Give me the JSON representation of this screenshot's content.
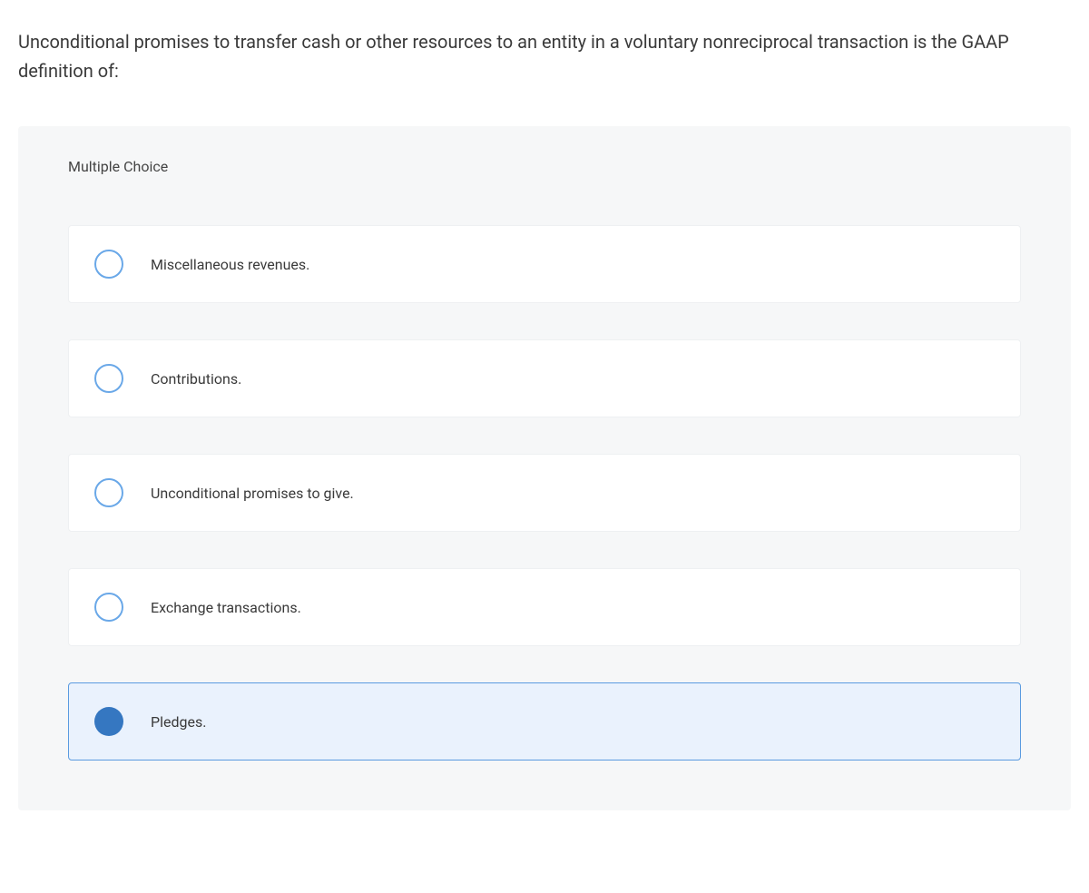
{
  "question": "Unconditional promises to transfer cash or other resources to an entity in a voluntary nonreciprocal transaction is the GAAP definition of:",
  "panel_heading": "Multiple Choice",
  "options": [
    {
      "label": "Miscellaneous revenues.",
      "selected": false
    },
    {
      "label": "Contributions.",
      "selected": false
    },
    {
      "label": "Unconditional promises to give.",
      "selected": false
    },
    {
      "label": "Exchange transactions.",
      "selected": false
    },
    {
      "label": "Pledges.",
      "selected": true
    }
  ]
}
